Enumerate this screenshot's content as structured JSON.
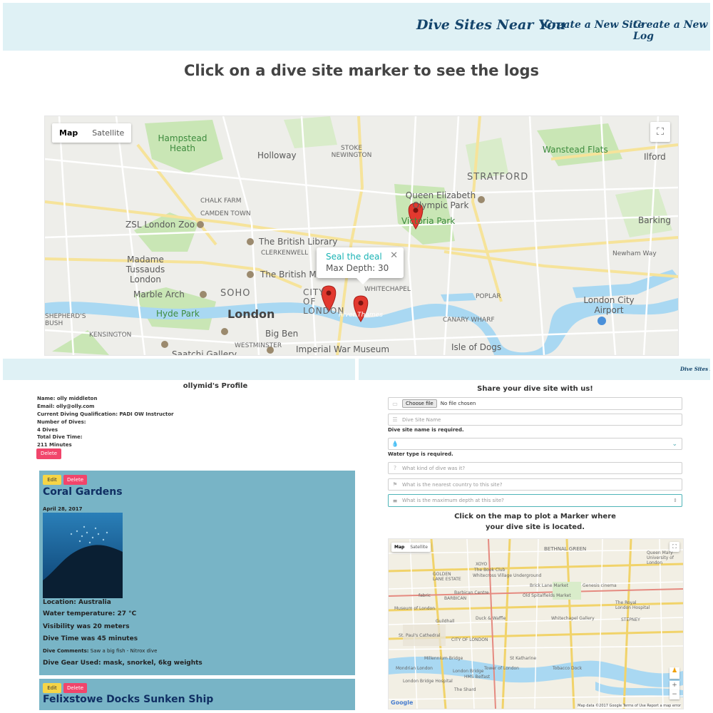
{
  "nav": {
    "brand": "Dive Sites Near You",
    "links": [
      "Create a New Site",
      "Create a New Log"
    ],
    "brand_small": "Dive Sites Near"
  },
  "heading": "Click on a dive site marker to see the logs",
  "main_map": {
    "toggle": [
      "Map",
      "Satellite"
    ],
    "popup": {
      "title": "Seal the deal",
      "depth": "Max Depth: 30"
    },
    "labels": {
      "hampstead": "Hampstead Heath",
      "holloway": "Holloway",
      "stoke": "STOKE NEWINGTON",
      "wanstead": "Wanstead Flats",
      "ilford": "Ilford",
      "stratford": "STRATFORD",
      "olympic": "Queen Elizabeth Olympic Park",
      "victoria": "Victoria Park",
      "chalk": "CHALK FARM",
      "camden": "CAMDEN TOWN",
      "zsl": "ZSL London Zoo",
      "library": "The British Library",
      "clerkenwell": "CLERKENWELL",
      "madame": "Madame Tussauds London",
      "museum": "The British Museum",
      "marble": "Marble Arch",
      "soho": "SOHO",
      "city": "CITY OF LONDON",
      "whitechapel": "WHITECHAPEL",
      "hyde": "Hyde Park",
      "london": "London",
      "bigben": "Big Ben",
      "westminster": "WESTMINSTER",
      "iwm": "Imperial War Museum",
      "saatchi": "Saatchi Gallery",
      "poplar": "POPLAR",
      "canary": "CANARY WHARF",
      "isle": "Isle of Dogs",
      "airport": "London City Airport",
      "barking": "Barking",
      "newham": "Newham Way",
      "thames": "River Thames",
      "kensington": "KENSINGTON",
      "shepherds": "SHEPHERD'S BUSH"
    }
  },
  "profile": {
    "title": "ollymid's Profile",
    "name": "Name: olly middleton",
    "email": "Email: olly@olly.com",
    "qualification": "Current Diving Qualification: PADI OW Instructor",
    "num_dives_label": "Number of Dives:",
    "num_dives": "4 Dives",
    "total_time_label": "Total Dive Time:",
    "total_time": "211 Minutes",
    "delete_label": "Delete"
  },
  "logs": [
    {
      "edit": "Edit",
      "delete": "Delete",
      "title": "Coral Gardens",
      "date": "April 28, 2017",
      "location": "Location: Australia",
      "water_temp": "Water temperature: 27 °C",
      "visibility": "Visibility was 20 meters",
      "dive_time": "Dive Time was 45 minutes",
      "comments_label": "Dive Comments:",
      "comments": "Saw a big fish - Nitrox dive",
      "gear": "Dive Gear Used: mask, snorkel, 6kg weights"
    },
    {
      "edit": "Edit",
      "delete": "Delete",
      "title": "Felixstowe Docks Sunken Ship"
    }
  ],
  "form": {
    "title": "Share your dive site with us!",
    "choose_file": "Choose file",
    "no_file": "No file chosen",
    "name_placeholder": "Dive Site Name",
    "name_required": "Dive site name is required.",
    "water_required": "Water type is required.",
    "kind_placeholder": "What kind of dive was it?",
    "country_placeholder": "What is the nearest country to this site?",
    "depth_placeholder": "What is the maximum depth at this site?",
    "plot_text": "Click on the map to plot a Marker where your dive site is located."
  },
  "small_map": {
    "toggle": [
      "Map",
      "Satellite"
    ],
    "labels": {
      "bethnal": "BETHNAL GREEN",
      "queenmary": "Queen Mary University of London",
      "xoyo": "XOYO",
      "bookclub": "The Book Club",
      "whitecross": "Whitecross Village Underground",
      "golden": "GOLDEN LANE ESTATE",
      "bricklane": "Brick Lane Market",
      "genesis": "Genesis cinema",
      "barbican": "Barbican Centre",
      "barbican2": "BARBICAN",
      "fabric": "fabric",
      "spitalfields": "Old Spitalfields Market",
      "royal": "The Royal London Hospital",
      "museumlondon": "Museum of London",
      "whitechapelg": "Whitechapel Gallery",
      "stepney": "STEPNEY",
      "guildhall": "Guildhall",
      "duckwaffle": "Duck & Waffle",
      "stpauls": "St. Paul's Cathedral",
      "cityof": "CITY OF LONDON",
      "millennium": "Millennium Bridge",
      "londonbridge": "London Bridge",
      "tower": "Tower of London",
      "belfast": "HMS Belfast",
      "tobacco": "Tobacco Dock",
      "shard": "The Shard",
      "mondrian": "Mondrian London",
      "bridgehosp": "London Bridge Hospital",
      "stkatherine": "St Katharine",
      "google": "Google",
      "mapdata": "Map data ©2017 Google",
      "terms": "Terms of Use",
      "report": "Report a map error"
    }
  },
  "colors": {
    "nav_bg": "#dff1f5",
    "brand": "#13446b",
    "card_bg": "#78b4c6",
    "card_title": "#102f63",
    "delete_btn": "#f1456b",
    "edit_btn": "#f6d546",
    "popup_title": "#1ab3b5",
    "water": "#a9d8f2",
    "park": "#c9e6b5",
    "marker": "#e2392f"
  },
  "icons": {
    "marker": "map-pin-icon",
    "fullscreen": "fullscreen-icon",
    "close": "close-icon",
    "image": "image-icon",
    "name": "id-card-icon",
    "water": "droplet-icon",
    "question": "question-icon",
    "flag": "flag-icon",
    "depth": "ruler-icon",
    "pegman": "pegman-icon",
    "zoom_in": "zoom-in-icon",
    "zoom_out": "zoom-out-icon"
  }
}
